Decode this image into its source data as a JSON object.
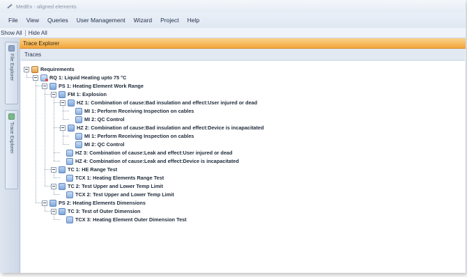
{
  "window": {
    "title": "MedEx - aligned elements"
  },
  "menu": [
    "File",
    "View",
    "Queries",
    "User Management",
    "Wizard",
    "Project",
    "Help"
  ],
  "toolbar": {
    "show_all": "Show All",
    "hide_all": "Hide All"
  },
  "side_tabs": {
    "file_explorer": "File Explorer",
    "trace_explorer": "Trace Explorer"
  },
  "panel": {
    "title": "Trace Explorer",
    "subtitle": "Traces"
  },
  "tree": [
    {
      "label": "Requirements",
      "level": 0,
      "expander": true,
      "icon": "requirements-folder"
    },
    {
      "label": "RQ 1: Liquid Heating upto 75 °C",
      "level": 1,
      "expander": true,
      "icon": "requirement"
    },
    {
      "label": "PS 1: Heating Element Work Range",
      "level": 2,
      "expander": true,
      "icon": "node"
    },
    {
      "label": "FM 1: Explosion",
      "level": 3,
      "expander": true,
      "icon": "node"
    },
    {
      "label": "HZ 1: Combination of cause:Bad insulation and effect:User injured or dead",
      "level": 4,
      "expander": true,
      "icon": "node"
    },
    {
      "label": "MI 1: Perform Receiving Inspection on cables",
      "level": 5,
      "expander": false,
      "icon": "leaf"
    },
    {
      "label": "MI 2: QC Control",
      "level": 5,
      "expander": false,
      "icon": "leaf"
    },
    {
      "label": "HZ 2: Combination of cause:Bad insulation and effect:Device is incapacitated",
      "level": 4,
      "expander": true,
      "icon": "node"
    },
    {
      "label": "MI 1: Perform Receiving Inspection on cables",
      "level": 5,
      "expander": false,
      "icon": "leaf"
    },
    {
      "label": "MI 2: QC Control",
      "level": 5,
      "expander": false,
      "icon": "leaf"
    },
    {
      "label": "HZ 3: Combination of cause:Leak and effect:User injured or dead",
      "level": 4,
      "expander": false,
      "icon": "leaf"
    },
    {
      "label": "HZ 4: Combination of cause:Leak and effect:Device is incapacitated",
      "level": 4,
      "expander": false,
      "icon": "leaf"
    },
    {
      "label": "TC 1: HE Range Test",
      "level": 3,
      "expander": true,
      "icon": "node"
    },
    {
      "label": "TCX 1: Heating Elements Range Test",
      "level": 4,
      "expander": false,
      "icon": "leaf"
    },
    {
      "label": "TC 2: Test Upper and Lower Temp Limit",
      "level": 3,
      "expander": true,
      "icon": "node"
    },
    {
      "label": "TCX 2: Test Upper and Lower Temp Limit",
      "level": 4,
      "expander": false,
      "icon": "leaf"
    },
    {
      "label": "PS 2: Heating Elements Dimensions",
      "level": 2,
      "expander": true,
      "icon": "node"
    },
    {
      "label": "TC 3: Test of Outer Dimension",
      "level": 3,
      "expander": true,
      "icon": "node"
    },
    {
      "label": "TCX 3: Heating Element Outer Dimension Test",
      "level": 4,
      "expander": false,
      "icon": "leaf"
    }
  ]
}
